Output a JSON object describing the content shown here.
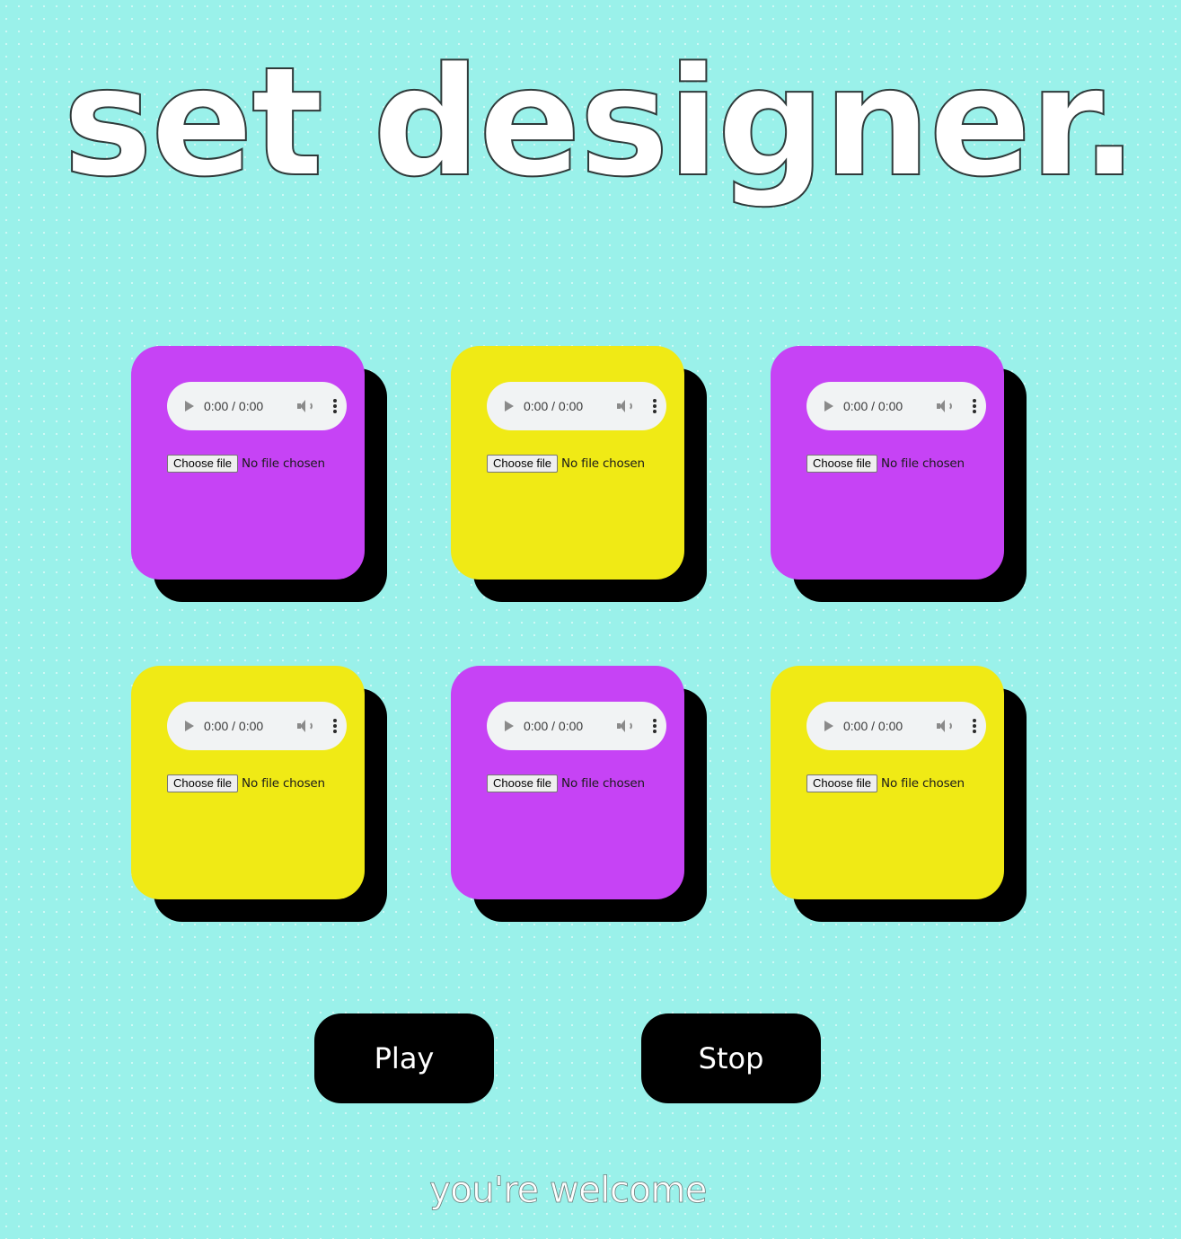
{
  "title": "set designer.",
  "colors": {
    "background": "#9af1ea",
    "purple": "#c643f5",
    "yellow": "#f0ea15",
    "shadow": "#000000",
    "button_bg": "#000000"
  },
  "pads": [
    {
      "color": "purple",
      "audio_time": "0:00 / 0:00",
      "file_button": "Choose file",
      "file_status": "No file chosen"
    },
    {
      "color": "yellow",
      "audio_time": "0:00 / 0:00",
      "file_button": "Choose file",
      "file_status": "No file chosen"
    },
    {
      "color": "purple",
      "audio_time": "0:00 / 0:00",
      "file_button": "Choose file",
      "file_status": "No file chosen"
    },
    {
      "color": "yellow",
      "audio_time": "0:00 / 0:00",
      "file_button": "Choose file",
      "file_status": "No file chosen"
    },
    {
      "color": "purple",
      "audio_time": "0:00 / 0:00",
      "file_button": "Choose file",
      "file_status": "No file chosen"
    },
    {
      "color": "yellow",
      "audio_time": "0:00 / 0:00",
      "file_button": "Choose file",
      "file_status": "No file chosen"
    }
  ],
  "controls": {
    "play_label": "Play",
    "stop_label": "Stop"
  },
  "footer": "you're welcome"
}
